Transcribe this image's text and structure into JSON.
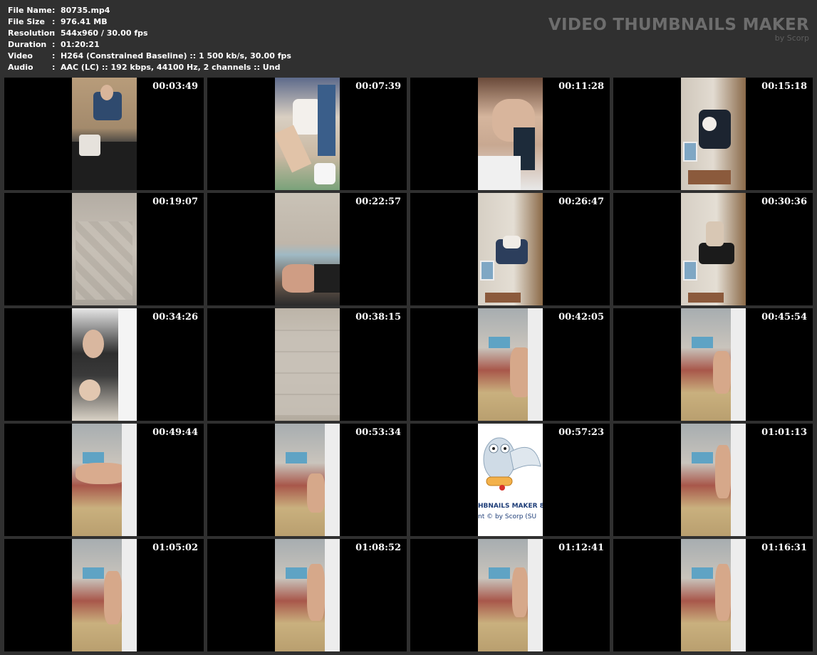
{
  "info": [
    {
      "label": "File Name",
      "sep": ":",
      "value": "80735.mp4"
    },
    {
      "label": "File Size",
      "sep": ":",
      "value": "976.41 MB"
    },
    {
      "label": "Resolution",
      "sep": ":",
      "value": "544x960 / 30.00 fps"
    },
    {
      "label": "Duration",
      "sep": ":",
      "value": "01:20:21"
    },
    {
      "label": "Video",
      "sep": ":",
      "value": "H264 (Constrained Baseline) :: 1 500 kb/s, 30.00 fps"
    },
    {
      "label": "Audio",
      "sep": ":",
      "value": "AAC (LC) :: 192 kbps, 44100 Hz, 2 channels :: Und"
    }
  ],
  "logo": {
    "title": "VIDEO THUMBNAILS MAKER",
    "subtitle": "by Scorp"
  },
  "thumbnails": [
    {
      "timestamp": "00:03:49"
    },
    {
      "timestamp": "00:07:39"
    },
    {
      "timestamp": "00:11:28"
    },
    {
      "timestamp": "00:15:18"
    },
    {
      "timestamp": "00:19:07"
    },
    {
      "timestamp": "00:22:57"
    },
    {
      "timestamp": "00:26:47"
    },
    {
      "timestamp": "00:30:36"
    },
    {
      "timestamp": "00:34:26"
    },
    {
      "timestamp": "00:38:15"
    },
    {
      "timestamp": "00:42:05"
    },
    {
      "timestamp": "00:45:54"
    },
    {
      "timestamp": "00:49:44"
    },
    {
      "timestamp": "00:53:34"
    },
    {
      "timestamp": "00:57:23",
      "logo_frame": {
        "line1": "HBNAILS MAKER 8",
        "line2": "nt © by Scorp (SU"
      }
    },
    {
      "timestamp": "01:01:13"
    },
    {
      "timestamp": "01:05:02"
    },
    {
      "timestamp": "01:08:52"
    },
    {
      "timestamp": "01:12:41"
    },
    {
      "timestamp": "01:16:31"
    }
  ]
}
